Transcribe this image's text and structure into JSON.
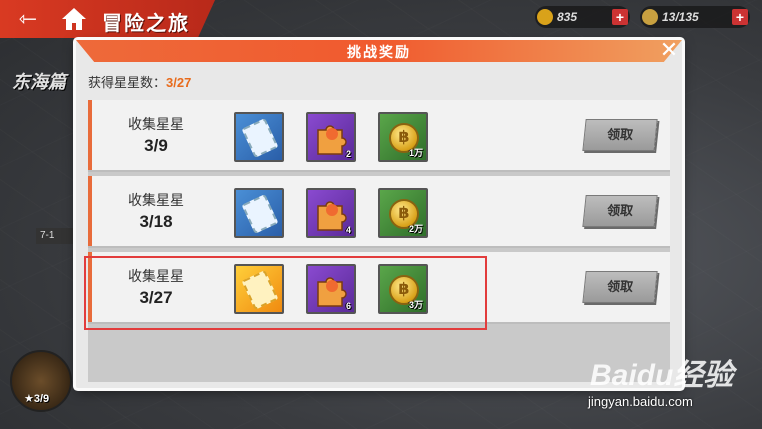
{
  "header": {
    "back_icon": "back-arrow-icon",
    "home_icon": "home-icon",
    "title": "冒险之旅",
    "resources": [
      {
        "icon": "coin-icon",
        "value": "835",
        "color": "#d9a21a"
      },
      {
        "icon": "stamina-icon",
        "value": "13/135",
        "color": "#c8a040"
      }
    ]
  },
  "background": {
    "chapter": "东海篇",
    "stage": "7-1",
    "chest_stars": "★3/9"
  },
  "modal": {
    "title": "挑战奖励",
    "close_icon": "close-icon",
    "star_label": "获得星星数：",
    "star_value": "3/27",
    "rows": [
      {
        "label": "收集星星",
        "progress": "3/9",
        "items": [
          {
            "type": "ticket",
            "color": "blue",
            "qty": ""
          },
          {
            "type": "puzzle",
            "color": "purple",
            "qty": "2"
          },
          {
            "type": "coin",
            "color": "green",
            "qty": "1万"
          }
        ],
        "claim_label": "领取"
      },
      {
        "label": "收集星星",
        "progress": "3/18",
        "items": [
          {
            "type": "ticket",
            "color": "blue",
            "qty": ""
          },
          {
            "type": "puzzle",
            "color": "purple",
            "qty": "4"
          },
          {
            "type": "coin",
            "color": "green",
            "qty": "2万"
          }
        ],
        "claim_label": "领取"
      },
      {
        "label": "收集星星",
        "progress": "3/27",
        "items": [
          {
            "type": "ticket",
            "color": "gold",
            "qty": ""
          },
          {
            "type": "puzzle",
            "color": "purple",
            "qty": "6"
          },
          {
            "type": "coin",
            "color": "green",
            "qty": "3万"
          }
        ],
        "claim_label": "领取"
      }
    ]
  },
  "watermark": {
    "logo": "Baidu经验",
    "url": "jingyan.baidu.com"
  }
}
